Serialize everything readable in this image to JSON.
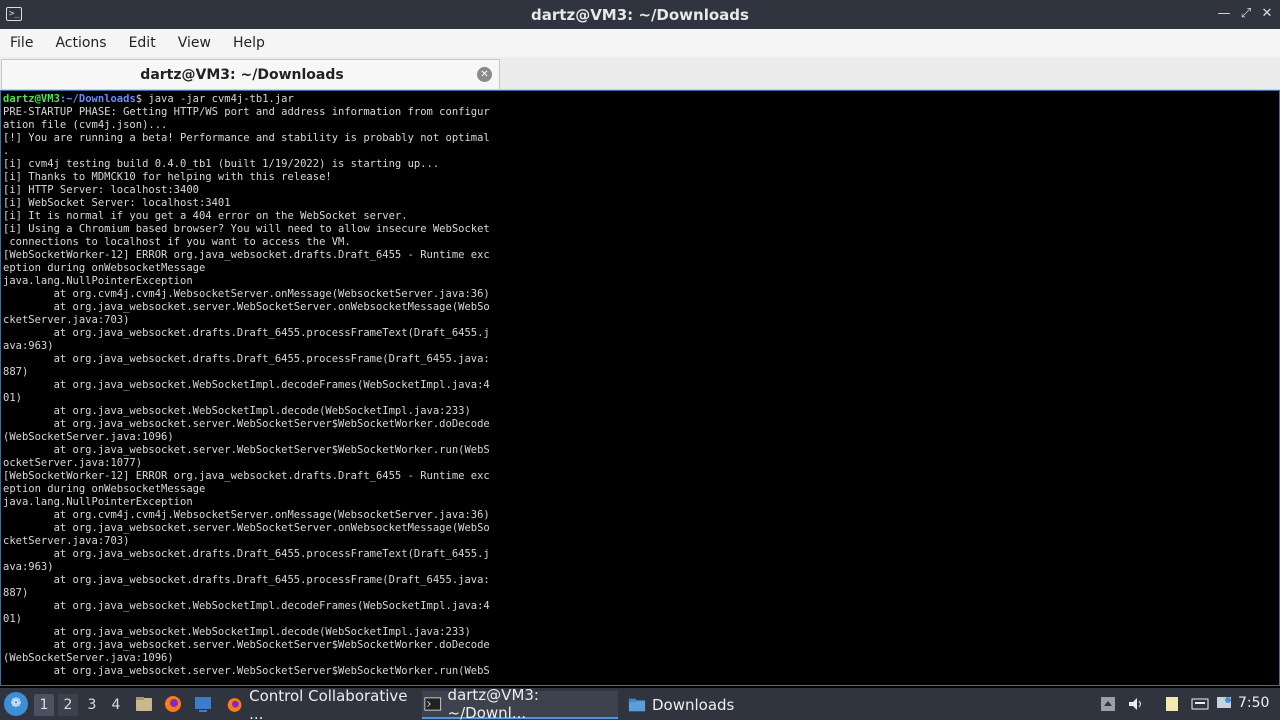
{
  "window": {
    "title": "dartz@VM3: ~/Downloads",
    "app_icon": "terminal-icon"
  },
  "menu": [
    "File",
    "Actions",
    "Edit",
    "View",
    "Help"
  ],
  "tab": {
    "label": "dartz@VM3: ~/Downloads"
  },
  "terminal": {
    "prompt_user": "dartz@VM3",
    "prompt_path": ":~/Downloads",
    "command": "$ java -jar cvm4j-tb1.jar",
    "lines": [
      "PRE-STARTUP PHASE: Getting HTTP/WS port and address information from configur",
      "ation file (cvm4j.json)...",
      "[!] You are running a beta! Performance and stability is probably not optimal",
      ".",
      "[i] cvm4j testing build 0.4.0_tb1 (built 1/19/2022) is starting up...",
      "[i] Thanks to MDMCK10 for helping with this release!",
      "[i] HTTP Server: localhost:3400",
      "[i] WebSocket Server: localhost:3401",
      "[i] It is normal if you get a 404 error on the WebSocket server.",
      "[i] Using a Chromium based browser? You will need to allow insecure WebSocket",
      " connections to localhost if you want to access the VM.",
      "[WebSocketWorker-12] ERROR org.java_websocket.drafts.Draft_6455 - Runtime exc",
      "eption during onWebsocketMessage",
      "java.lang.NullPointerException",
      "        at org.cvm4j.cvm4j.WebsocketServer.onMessage(WebsocketServer.java:36)",
      "        at org.java_websocket.server.WebSocketServer.onWebsocketMessage(WebSo",
      "cketServer.java:703)",
      "        at org.java_websocket.drafts.Draft_6455.processFrameText(Draft_6455.j",
      "ava:963)",
      "        at org.java_websocket.drafts.Draft_6455.processFrame(Draft_6455.java:",
      "887)",
      "        at org.java_websocket.WebSocketImpl.decodeFrames(WebSocketImpl.java:4",
      "01)",
      "        at org.java_websocket.WebSocketImpl.decode(WebSocketImpl.java:233)",
      "        at org.java_websocket.server.WebSocketServer$WebSocketWorker.doDecode",
      "(WebSocketServer.java:1096)",
      "        at org.java_websocket.server.WebSocketServer$WebSocketWorker.run(WebS",
      "ocketServer.java:1077)",
      "[WebSocketWorker-12] ERROR org.java_websocket.drafts.Draft_6455 - Runtime exc",
      "eption during onWebsocketMessage",
      "java.lang.NullPointerException",
      "        at org.cvm4j.cvm4j.WebsocketServer.onMessage(WebsocketServer.java:36)",
      "        at org.java_websocket.server.WebSocketServer.onWebsocketMessage(WebSo",
      "cketServer.java:703)",
      "        at org.java_websocket.drafts.Draft_6455.processFrameText(Draft_6455.j",
      "ava:963)",
      "        at org.java_websocket.drafts.Draft_6455.processFrame(Draft_6455.java:",
      "887)",
      "        at org.java_websocket.WebSocketImpl.decodeFrames(WebSocketImpl.java:4",
      "01)",
      "        at org.java_websocket.WebSocketImpl.decode(WebSocketImpl.java:233)",
      "        at org.java_websocket.server.WebSocketServer$WebSocketWorker.doDecode",
      "(WebSocketServer.java:1096)",
      "        at org.java_websocket.server.WebSocketServer$WebSocketWorker.run(WebS"
    ]
  },
  "taskbar": {
    "workspaces": [
      "1",
      "2",
      "3",
      "4"
    ],
    "tasks": [
      {
        "label": "Control Collaborative ...",
        "icon": "firefox-icon"
      },
      {
        "label": "dartz@VM3: ~/Downl...",
        "icon": "terminal-icon"
      },
      {
        "label": "Downloads",
        "icon": "folder-icon"
      }
    ],
    "clock": "7:50"
  },
  "colors": {
    "titlebar": "#2f343f",
    "prompt_user": "#4ee44e",
    "prompt_path": "#6b8cff",
    "terminal_bg": "#000000"
  }
}
